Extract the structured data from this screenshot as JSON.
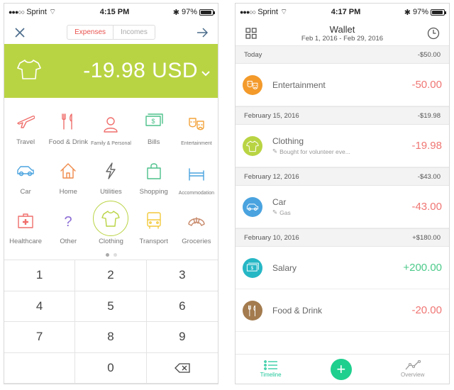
{
  "left": {
    "status": {
      "carrier": "Sprint",
      "time": "4:15 PM",
      "battery": "97%"
    },
    "tabs": {
      "expenses": "Expenses",
      "incomes": "Incomes"
    },
    "amount": "-19.98 USD",
    "categories": [
      {
        "label": "Travel",
        "icon": "airplane-icon",
        "color": "#ef6f6c"
      },
      {
        "label": "Food & Drink",
        "icon": "fork-knife-icon",
        "color": "#ef6f6c"
      },
      {
        "label": "Family & Personal",
        "icon": "person-icon",
        "color": "#ef6f6c"
      },
      {
        "label": "Bills",
        "icon": "money-icon",
        "color": "#4cc08a"
      },
      {
        "label": "Entertainment",
        "icon": "masks-icon",
        "color": "#f3a33b"
      },
      {
        "label": "Car",
        "icon": "car-icon",
        "color": "#4aa3df"
      },
      {
        "label": "Home",
        "icon": "house-icon",
        "color": "#ef8a4a"
      },
      {
        "label": "Utilities",
        "icon": "bolt-icon",
        "color": "#666666"
      },
      {
        "label": "Shopping",
        "icon": "bag-icon",
        "color": "#4cc08a"
      },
      {
        "label": "Accommodation",
        "icon": "bed-icon",
        "color": "#4aa3df"
      },
      {
        "label": "Healthcare",
        "icon": "medkit-icon",
        "color": "#ef6f6c"
      },
      {
        "label": "Other",
        "icon": "question-icon",
        "color": "#8e6fd6"
      },
      {
        "label": "Clothing",
        "icon": "shirt-icon",
        "color": "#b9d443"
      },
      {
        "label": "Transport",
        "icon": "bus-icon",
        "color": "#f3c93b"
      },
      {
        "label": "Groceries",
        "icon": "croissant-icon",
        "color": "#c7896a"
      }
    ],
    "keys": [
      "1",
      "2",
      "3",
      "4",
      "5",
      "6",
      "7",
      "8",
      "9",
      "",
      "0",
      "backspace"
    ]
  },
  "right": {
    "status": {
      "carrier": "Sprint",
      "time": "4:17 PM",
      "battery": "97%"
    },
    "title": "Wallet",
    "date_range": "Feb 1, 2016 - Feb 29, 2016",
    "groups": [
      {
        "date": "Today",
        "total": "-$50.00",
        "items": [
          {
            "name": "Entertainment",
            "note": "",
            "value": "-50.00",
            "sign": "neg",
            "color": "#f39a2b",
            "icon": "masks-icon"
          }
        ]
      },
      {
        "date": "February 15, 2016",
        "total": "-$19.98",
        "items": [
          {
            "name": "Clothing",
            "note": "Bought for volunteer eve...",
            "value": "-19.98",
            "sign": "neg",
            "color": "#b9d443",
            "icon": "shirt-icon"
          }
        ]
      },
      {
        "date": "February 12, 2016",
        "total": "-$43.00",
        "items": [
          {
            "name": "Car",
            "note": "Gas",
            "value": "-43.00",
            "sign": "neg",
            "color": "#4aa3df",
            "icon": "car-icon"
          }
        ]
      },
      {
        "date": "February 10, 2016",
        "total": "+$180.00",
        "items": [
          {
            "name": "Salary",
            "note": "",
            "value": "+200.00",
            "sign": "pos",
            "color": "#26b7c5",
            "icon": "money-icon"
          },
          {
            "name": "Food & Drink",
            "note": "",
            "value": "-20.00",
            "sign": "neg",
            "color": "#a37b4e",
            "icon": "fork-knife-icon"
          }
        ]
      }
    ],
    "tabs": {
      "timeline": "Timeline",
      "overview": "Overview"
    }
  }
}
